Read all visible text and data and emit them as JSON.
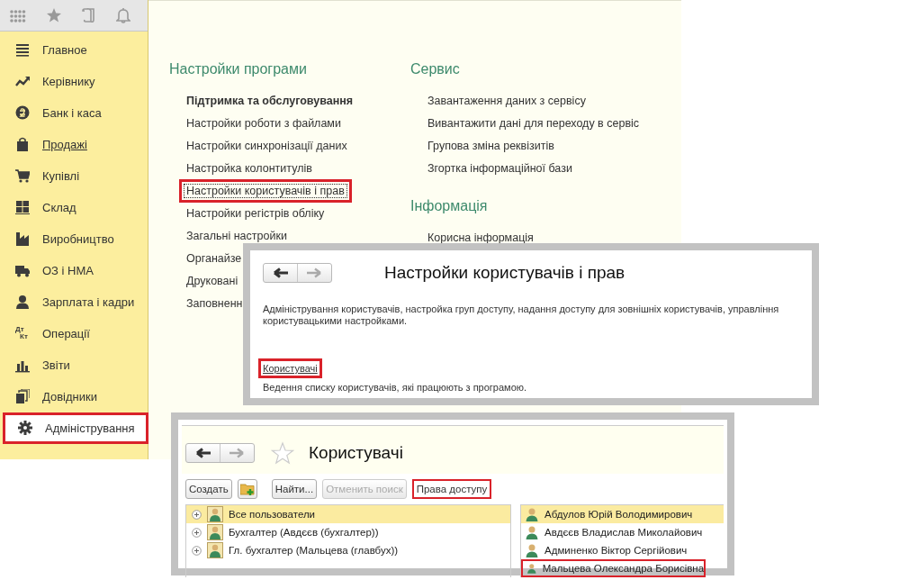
{
  "sidebar": {
    "items": [
      {
        "label": "Главное",
        "selected": false,
        "underlined": false,
        "highlighted": false
      },
      {
        "label": "Керівнику",
        "selected": false,
        "underlined": false,
        "highlighted": false
      },
      {
        "label": "Банк і каса",
        "selected": false,
        "underlined": false,
        "highlighted": false
      },
      {
        "label": "Продажі",
        "selected": false,
        "underlined": true,
        "highlighted": false
      },
      {
        "label": "Купівлі",
        "selected": false,
        "underlined": false,
        "highlighted": false
      },
      {
        "label": "Склад",
        "selected": false,
        "underlined": false,
        "highlighted": false
      },
      {
        "label": "Виробництво",
        "selected": false,
        "underlined": false,
        "highlighted": false
      },
      {
        "label": "ОЗ і НМА",
        "selected": false,
        "underlined": false,
        "highlighted": false
      },
      {
        "label": "Зарплата і кадри",
        "selected": false,
        "underlined": false,
        "highlighted": false
      },
      {
        "label": "Операції",
        "selected": false,
        "underlined": false,
        "highlighted": false,
        "icon_text": [
          "Дт",
          "Кт"
        ]
      },
      {
        "label": "Звіти",
        "selected": false,
        "underlined": false,
        "highlighted": false
      },
      {
        "label": "Довідники",
        "selected": false,
        "underlined": false,
        "highlighted": false
      },
      {
        "label": "Адміністрування",
        "selected": true,
        "underlined": false,
        "highlighted": true
      }
    ]
  },
  "content": {
    "columns": [
      {
        "sections": [
          {
            "title": "Настройки програми",
            "items": [
              {
                "label": "Підтримка та обслуговування",
                "bold": true,
                "highlighted": false,
                "focused": false
              },
              {
                "label": "Настройки роботи з файлами",
                "bold": false,
                "highlighted": false,
                "focused": false
              },
              {
                "label": "Настройки синхронізації даних",
                "bold": false,
                "highlighted": false,
                "focused": false
              },
              {
                "label": "Настройка колонтитулів",
                "bold": false,
                "highlighted": false,
                "focused": false
              },
              {
                "label": "Настройки користувачів і прав",
                "bold": false,
                "highlighted": true,
                "focused": true
              },
              {
                "label": "Настройки регістрів обліку",
                "bold": false,
                "highlighted": false,
                "focused": false
              },
              {
                "label": "Загальні настройки",
                "bold": false,
                "highlighted": false,
                "focused": false
              },
              {
                "label": "Органайзе",
                "bold": false,
                "highlighted": false,
                "focused": false
              },
              {
                "label": "Друковані",
                "bold": false,
                "highlighted": false,
                "focused": false
              },
              {
                "label": "Заповненн",
                "bold": false,
                "highlighted": false,
                "focused": false
              }
            ]
          }
        ]
      },
      {
        "sections": [
          {
            "title": "Сервис",
            "items": [
              {
                "label": "Завантаження даних з сервісу",
                "bold": false,
                "highlighted": false,
                "focused": false
              },
              {
                "label": "Вивантажити дані для переходу в сервіс",
                "bold": false,
                "highlighted": false,
                "focused": false
              },
              {
                "label": "Групова зміна реквізитів",
                "bold": false,
                "highlighted": false,
                "focused": false
              },
              {
                "label": "Згортка інформаційної бази",
                "bold": false,
                "highlighted": false,
                "focused": false
              }
            ]
          },
          {
            "title": "Інформація",
            "items": [
              {
                "label": "Корисна інформація",
                "bold": false,
                "highlighted": false,
                "focused": false
              }
            ]
          }
        ]
      }
    ]
  },
  "settings_window": {
    "title": "Настройки користувачів і прав",
    "description": "Адміністрування користувачів, настройка груп доступу, надання доступу для зовнішніх користувачів, управління користувацькими настройками.",
    "link": {
      "label": "Користувачі",
      "highlighted": true
    },
    "link_description": "Ведення списку користувачів, які працюють з програмою."
  },
  "users_window": {
    "title": "Користувачі",
    "favorite": false,
    "toolbar": [
      {
        "kind": "text",
        "label": "Создать",
        "disabled": false,
        "highlighted": false
      },
      {
        "kind": "icon",
        "disabled": false,
        "highlighted": false
      },
      {
        "kind": "text",
        "label": "Найти...",
        "disabled": false,
        "highlighted": false
      },
      {
        "kind": "text",
        "label": "Отменить поиск",
        "disabled": true,
        "highlighted": false
      },
      {
        "kind": "text",
        "label": "Права доступу",
        "disabled": false,
        "highlighted": true
      }
    ],
    "groups": [
      {
        "label": "Все пользователи",
        "selected": true
      },
      {
        "label": "Бухгалтер (Авдєєв (бухгалтер))",
        "selected": false
      },
      {
        "label": "Гл. бухгалтер (Мальцева (главбух))",
        "selected": false
      }
    ],
    "users": [
      {
        "name": "Абдулов Юрій Володимирович",
        "selected": true,
        "highlighted": false
      },
      {
        "name": "Авдєєв Владислав Миколайович",
        "selected": false,
        "highlighted": false
      },
      {
        "name": "Админенко Віктор Сергійович",
        "selected": false,
        "highlighted": false
      },
      {
        "name": "Мальцева Олександра Борисівна",
        "selected": false,
        "highlighted": true
      }
    ]
  }
}
